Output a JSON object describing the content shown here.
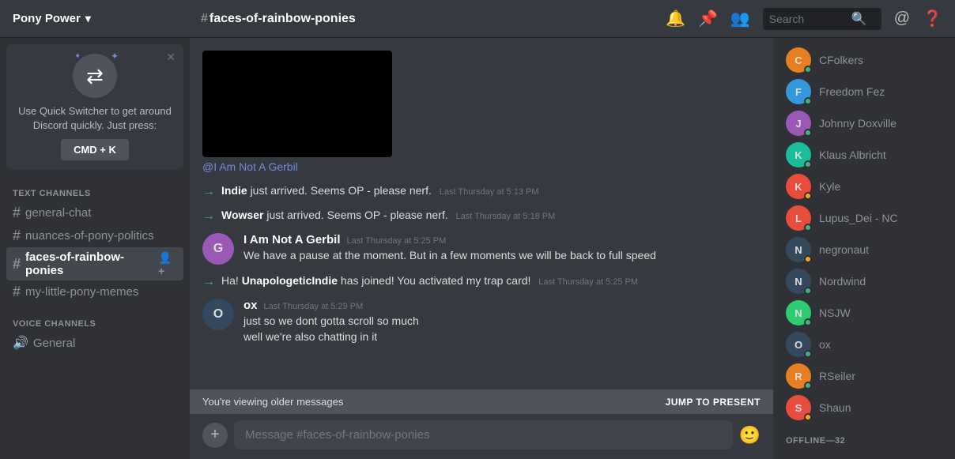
{
  "topbar": {
    "server_name": "Pony Power",
    "channel_name": "faces-of-rainbow-ponies",
    "search_placeholder": "Search"
  },
  "sidebar": {
    "text_channels_label": "TEXT CHANNELS",
    "channels": [
      {
        "name": "general-chat",
        "active": false
      },
      {
        "name": "nuances-of-pony-politics",
        "active": false
      },
      {
        "name": "faces-of-rainbow-ponies",
        "active": true
      },
      {
        "name": "my-little-pony-memes",
        "active": false
      }
    ],
    "voice_channels_label": "VOICE CHANNELS",
    "voice_channels": [
      {
        "name": "General"
      }
    ]
  },
  "quick_switcher": {
    "text": "Use Quick Switcher to get around Discord quickly. Just press:",
    "shortcut": "CMD + K"
  },
  "messages": {
    "image_mention": "@I Am Not A Gerbil",
    "system": [
      {
        "text_before": "Indie",
        "text_after": "just arrived. Seems OP - please nerf.",
        "timestamp": "Last Thursday at 5:13 PM"
      },
      {
        "text_before": "Wowser",
        "text_after": "just arrived. Seems OP - please nerf.",
        "timestamp": "Last Thursday at 5:18 PM"
      }
    ],
    "chat": [
      {
        "username": "I Am Not A Gerbil",
        "timestamp": "Last Thursday at 5:25 PM",
        "lines": [
          "We have a pause at the moment. But in a few moments we will be back to full speed"
        ],
        "av_color": "av-purple",
        "av_letter": "G"
      },
      {
        "username": "ox",
        "timestamp": "Last Thursday at 5:29 PM",
        "lines": [
          "just so we dont gotta scroll so much",
          "well we're also chatting in it"
        ],
        "av_color": "av-dark",
        "av_letter": "O"
      }
    ],
    "join_msg": {
      "text_before": "Ha! ",
      "join_user": "UnapologeticIndie",
      "text_after": " has joined! You activated my trap card!",
      "timestamp": "Last Thursday at 5:25 PM"
    },
    "older_banner": "You're viewing older messages",
    "jump_btn": "JUMP TO PRESENT",
    "input_placeholder": "Message #faces-of-rainbow-ponies"
  },
  "members": {
    "online_label": "",
    "list": [
      {
        "name": "CFolkers",
        "status": "online",
        "av_color": "av-orange",
        "av_letter": "C"
      },
      {
        "name": "Freedom Fez",
        "status": "online",
        "av_color": "av-blue",
        "av_letter": "F"
      },
      {
        "name": "Johnny Doxville",
        "status": "online",
        "av_color": "av-purple",
        "av_letter": "J"
      },
      {
        "name": "Klaus Albricht",
        "status": "online",
        "av_color": "av-teal",
        "av_letter": "K"
      },
      {
        "name": "Kyle",
        "status": "idle",
        "av_color": "av-red",
        "av_letter": "K"
      },
      {
        "name": "Lupus_Dei - NC",
        "status": "online",
        "av_color": "av-red",
        "av_letter": "L"
      },
      {
        "name": "negronaut",
        "status": "idle",
        "av_color": "av-dark",
        "av_letter": "N"
      },
      {
        "name": "Nordwind",
        "status": "online",
        "av_color": "av-dark",
        "av_letter": "N"
      },
      {
        "name": "NSJW",
        "status": "online",
        "av_color": "av-green",
        "av_letter": "N"
      },
      {
        "name": "ox",
        "status": "online",
        "av_color": "av-dark",
        "av_letter": "O"
      },
      {
        "name": "RSeiler",
        "status": "online",
        "av_color": "av-orange",
        "av_letter": "R"
      },
      {
        "name": "Shaun",
        "status": "idle",
        "av_color": "av-red",
        "av_letter": "S"
      }
    ],
    "offline_label": "OFFLINE—32"
  }
}
